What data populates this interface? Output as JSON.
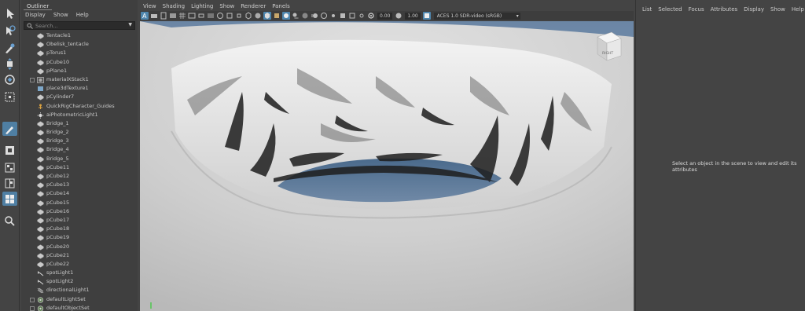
{
  "outliner": {
    "tab": "Outliner",
    "menu": [
      "Display",
      "Show",
      "Help"
    ],
    "search_placeholder": "Search...",
    "items": [
      {
        "label": "Tentacle1",
        "icon": "mesh-icon"
      },
      {
        "label": "Obelisk_tentacle",
        "icon": "mesh-icon"
      },
      {
        "label": "pTorus1",
        "icon": "mesh-icon"
      },
      {
        "label": "pCube10",
        "icon": "mesh-icon"
      },
      {
        "label": "pPlane1",
        "icon": "mesh-icon"
      },
      {
        "label": "materialXStack1",
        "icon": "material-stack-icon"
      },
      {
        "label": "place3dTexture1",
        "icon": "texture-placement-icon"
      },
      {
        "label": "pCylinder7",
        "icon": "mesh-icon"
      },
      {
        "label": "QuickRigCharacter_Guides",
        "icon": "rig-guides-icon"
      },
      {
        "label": "aiPhotometricLight1",
        "icon": "photometric-light-icon"
      },
      {
        "label": "Bridge_1",
        "icon": "mesh-icon"
      },
      {
        "label": "Bridge_2",
        "icon": "mesh-icon"
      },
      {
        "label": "Bridge_3",
        "icon": "mesh-icon"
      },
      {
        "label": "Bridge_4",
        "icon": "mesh-icon"
      },
      {
        "label": "Bridge_5",
        "icon": "mesh-icon"
      },
      {
        "label": "pCube11",
        "icon": "mesh-icon"
      },
      {
        "label": "pCube12",
        "icon": "mesh-icon"
      },
      {
        "label": "pCube13",
        "icon": "mesh-icon"
      },
      {
        "label": "pCube14",
        "icon": "mesh-icon"
      },
      {
        "label": "pCube15",
        "icon": "mesh-icon"
      },
      {
        "label": "pCube16",
        "icon": "mesh-icon"
      },
      {
        "label": "pCube17",
        "icon": "mesh-icon"
      },
      {
        "label": "pCube18",
        "icon": "mesh-icon"
      },
      {
        "label": "pCube19",
        "icon": "mesh-icon"
      },
      {
        "label": "pCube20",
        "icon": "mesh-icon"
      },
      {
        "label": "pCube21",
        "icon": "mesh-icon"
      },
      {
        "label": "pCube22",
        "icon": "mesh-icon"
      },
      {
        "label": "spotLight1",
        "icon": "spot-light-icon"
      },
      {
        "label": "spotLight2",
        "icon": "spot-light-icon"
      },
      {
        "label": "directionalLight1",
        "icon": "directional-light-icon"
      },
      {
        "label": "defaultLightSet",
        "icon": "set-icon"
      },
      {
        "label": "defaultObjectSet",
        "icon": "set-icon"
      }
    ]
  },
  "viewport": {
    "menu": [
      "View",
      "Shading",
      "Lighting",
      "Show",
      "Renderer",
      "Panels"
    ],
    "exposure": "0.00",
    "gamma": "1.00",
    "color_space": "ACES 1.0 SDR-video (sRGB)",
    "view_cube_label": "RIGHT"
  },
  "attribute_editor": {
    "menu": [
      "List",
      "Selected",
      "Focus",
      "Attributes",
      "Display",
      "Show",
      "Help"
    ],
    "empty_message": "Select an object in the scene to view and edit its attributes"
  },
  "colors": {
    "accent": "#4f86ad",
    "panel_bg": "#444444",
    "viewport_sky": "#6f8aa9"
  }
}
